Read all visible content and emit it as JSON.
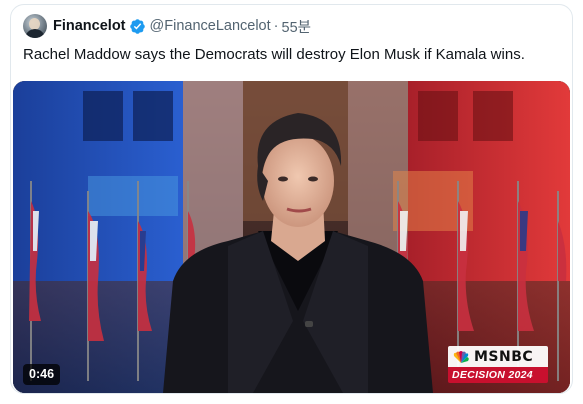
{
  "tweet": {
    "display_name": "Financelot",
    "verified_icon": "verified-badge-icon",
    "handle": "@FinanceLancelot",
    "separator": "·",
    "time": "55분",
    "text": "Rachel Maddow says the Democrats will destroy Elon Musk if Kamala wins."
  },
  "video": {
    "duration": "0:46",
    "network_logo": "MSNBC",
    "network_banner": "DECISION 2024"
  },
  "colors": {
    "verified_blue": "#1d9bf0",
    "handle_gray": "#536471",
    "text_dark": "#0f1419",
    "banner_red": "#c8102e"
  }
}
